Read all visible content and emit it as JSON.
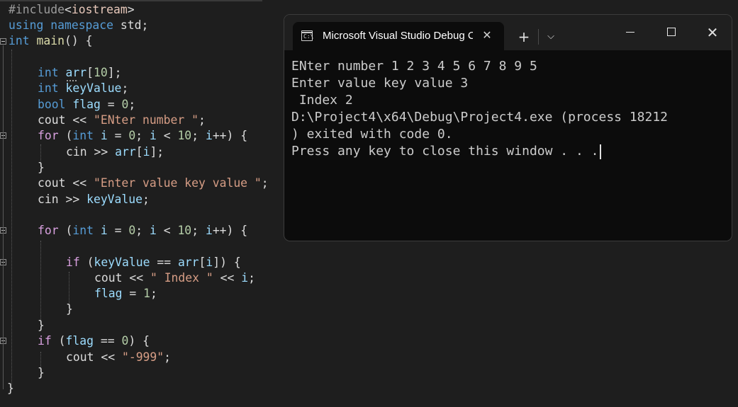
{
  "editor": {
    "include": {
      "directive": "#include",
      "lt": "<",
      "header": "iostream",
      "gt": ">"
    },
    "using_line": {
      "kw_using": "using",
      "kw_namespace": "namespace",
      "ns": " std;"
    },
    "main_line": {
      "kw_int": "int",
      "name": "main",
      "rest": "() {"
    },
    "decl_arr": {
      "kw": "int",
      "name": "arr",
      "rest1": "[",
      "size": "10",
      "rest2": "];"
    },
    "decl_key": {
      "kw": "int",
      "name": "keyValue",
      "rest": ";"
    },
    "decl_flag": {
      "kw": "bool",
      "name": "flag",
      "op": " = ",
      "val": "0",
      "end": ";"
    },
    "cout1": {
      "head": "cout << ",
      "str": "\"ENter number \"",
      "end": ";"
    },
    "for1": {
      "kw_for": "for",
      "p1": " (",
      "kw_int": "int",
      "i1": " i",
      "p2": " = ",
      "zero": "0",
      "p3": "; ",
      "i2": "i",
      "p4": " < ",
      "ten": "10",
      "p5": "; ",
      "i3": "i",
      "p6": "++) {"
    },
    "cin_arr": {
      "head": "cin >> ",
      "name": "arr",
      "p1": "[",
      "idx": "i",
      "p2": "];"
    },
    "close1": "}",
    "cout2": {
      "head": "cout << ",
      "str": "\"Enter value key value \"",
      "end": ";"
    },
    "cin_key": {
      "head": "cin >> ",
      "name": "keyValue",
      "end": ";"
    },
    "for2": {
      "kw_for": "for",
      "p1": " (",
      "kw_int": "int",
      "i1": " i",
      "p2": " = ",
      "zero": "0",
      "p3": "; ",
      "i2": "i",
      "p4": " < ",
      "ten": "10",
      "p5": "; ",
      "i3": "i",
      "p6": "++) {"
    },
    "if1": {
      "kw_if": "if",
      "p1": " (",
      "name": "keyValue",
      "p2": " == ",
      "arr": "arr",
      "p3": "[",
      "idx": "i",
      "p4": "]) {"
    },
    "cout3": {
      "head": "cout << ",
      "str": "\" Index \"",
      "mid": " << ",
      "idx": "i",
      "end": ";"
    },
    "flag_set": {
      "name": "flag",
      "op": " = ",
      "val": "1",
      "end": ";"
    },
    "close2": "}",
    "close3": "}",
    "if2": {
      "kw_if": "if",
      "p1": " (",
      "name": "flag",
      "p2": " == ",
      "val": "0",
      "p3": ") {"
    },
    "cout4": {
      "head": "cout << ",
      "str": "\"-999\"",
      "end": ";"
    },
    "close4": "}",
    "close5": "}"
  },
  "terminal": {
    "tab_title": "Microsoft Visual Studio Debug Console",
    "icon_text": "C:\\",
    "close_tab_icon": "✕",
    "new_tab_icon": "+",
    "dropdown_icon": "⌵",
    "close_window_icon": "✕",
    "lines": [
      "ENter number 1 2 3 4 5 6 7 8 9 5",
      "Enter value key value 3",
      " Index 2",
      "D:\\Project4\\x64\\Debug\\Project4.exe (process 18212",
      ") exited with code 0.",
      "Press any key to close this window . . ."
    ]
  }
}
